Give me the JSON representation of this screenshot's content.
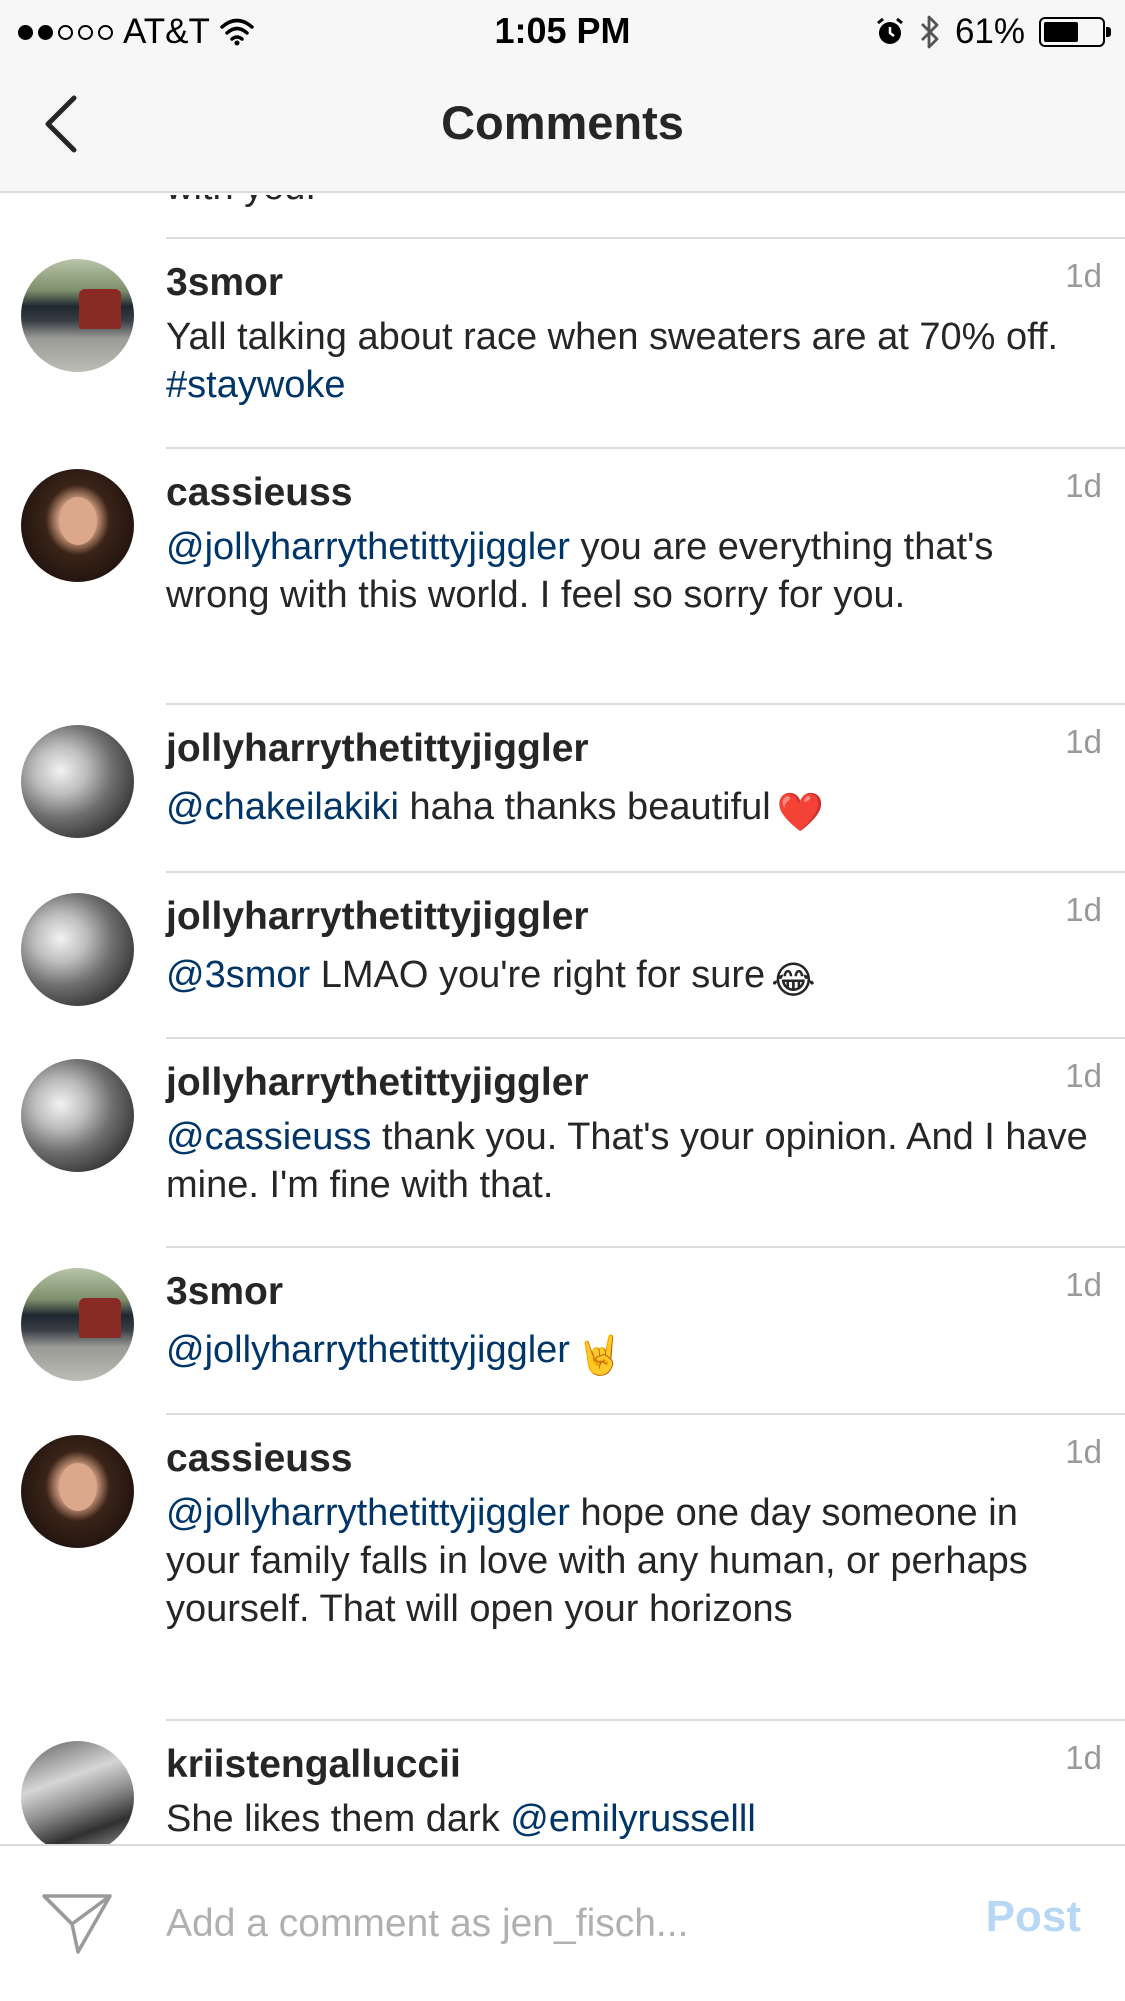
{
  "status_bar": {
    "carrier": "AT&T",
    "time": "1:05 PM",
    "battery": "61%",
    "battery_level": 0.61,
    "signal_bars_filled": 2,
    "signal_bars_total": 5
  },
  "header": {
    "title": "Comments",
    "back_icon": "chevron-left-icon"
  },
  "partial_text": "with you.",
  "comments": [
    {
      "username": "3smor",
      "time": "1d",
      "avatar": "cars",
      "segments": [
        {
          "text": "Yall talking about race when sweaters are at 70% off. ",
          "mention": false
        },
        {
          "text": "#staywoke",
          "mention": true
        }
      ]
    },
    {
      "username": "cassieuss",
      "time": "1d",
      "avatar": "woman",
      "segments": [
        {
          "text": "@jollyharrythetittyjiggler",
          "mention": true
        },
        {
          "text": " you are everything that's wrong with this world. I feel so sorry for you.",
          "mention": false
        }
      ]
    },
    {
      "username": "jollyharrythetittyjiggler",
      "time": "1d",
      "avatar": "bw",
      "segments": [
        {
          "text": "@chakeilakiki",
          "mention": true
        },
        {
          "text": " haha thanks beautiful",
          "mention": false
        }
      ],
      "emoji": "❤️"
    },
    {
      "username": "jollyharrythetittyjiggler",
      "time": "1d",
      "avatar": "bw",
      "segments": [
        {
          "text": "@3smor",
          "mention": true
        },
        {
          "text": " LMAO you're right for sure",
          "mention": false
        }
      ],
      "emoji": "😂"
    },
    {
      "username": "jollyharrythetittyjiggler",
      "time": "1d",
      "avatar": "bw",
      "segments": [
        {
          "text": "@cassieuss",
          "mention": true
        },
        {
          "text": " thank you. That's your opinion. And I have mine. I'm fine with that.",
          "mention": false
        }
      ]
    },
    {
      "username": "3smor",
      "time": "1d",
      "avatar": "cars",
      "segments": [
        {
          "text": "@jollyharrythetittyjiggler",
          "mention": true
        }
      ],
      "emoji": "🤘"
    },
    {
      "username": "cassieuss",
      "time": "1d",
      "avatar": "woman",
      "segments": [
        {
          "text": "@jollyharrythetittyjiggler",
          "mention": true
        },
        {
          "text": " hope one day someone in your family falls in love with any human, or perhaps yourself. That will open your horizons",
          "mention": false
        }
      ]
    },
    {
      "username": "kriistengalluccii",
      "time": "1d",
      "avatar": "bw2",
      "segments": [
        {
          "text": "She likes them dark ",
          "mention": false
        },
        {
          "text": "@emilyrusselll",
          "mention": true
        }
      ]
    }
  ],
  "input_bar": {
    "placeholder": "Add a comment as jen_fisch...",
    "post_label": "Post",
    "send_icon": "paper-plane-icon"
  },
  "colors": {
    "mention": "#003569",
    "post_disabled": "#b8d7f5",
    "timestamp": "#999999"
  }
}
